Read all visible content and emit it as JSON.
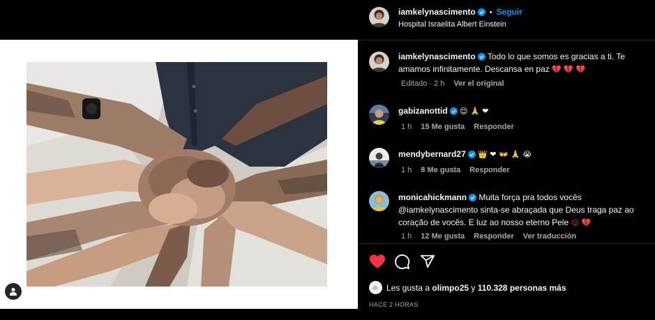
{
  "post": {
    "author": "iamkelynascimento",
    "follow_label": "Seguir",
    "location": "Hospital Israelita Albert Einstein"
  },
  "caption": {
    "username": "iamkelynascimento",
    "text": "Todo lo que somos es gracias a ti. Te amamos infinitamente. Descansa en paz",
    "emojis": "💔 💔 💔",
    "edited": "Editado · 2 h",
    "see_original": "Ver el original"
  },
  "comments": [
    {
      "username": "gabizanottid",
      "text": "",
      "emojis": "😌 🙏 ❤",
      "time": "1 h",
      "likes": "15 Me gusta",
      "reply": "Responder",
      "translate": ""
    },
    {
      "username": "mendybernard27",
      "text": "",
      "emojis": "👑 ❤ 👐 🙏 😭",
      "time": "1 h",
      "likes": "8 Me gusta",
      "reply": "Responder",
      "translate": ""
    },
    {
      "username": "monicahickmann",
      "text": "Muita força pra todos vocês @iamkelynascimento sinta-se abraçada que Deus traga paz ao coração de vocês. E luz ao nosso eterno Pele",
      "emojis": "😌 💔",
      "time": "1 h",
      "likes": "12 Me gusta",
      "reply": "Responder",
      "translate": "Ver traducción"
    }
  ],
  "likes_line": {
    "prefix": "Les gusta a",
    "user": "olimpo25",
    "middle": "y",
    "count": "110.328 personas más"
  },
  "timestamp": "HACE 2 HORAS",
  "icons": {
    "like": "heart-filled-icon",
    "comment": "comment-bubble-icon",
    "share": "paper-plane-icon",
    "verified": "verified-badge-icon",
    "user_tags": "user-tag-icon"
  },
  "colors": {
    "accent": "#0095f6",
    "like": "#ff3040",
    "background": "#000000",
    "muted": "#a8a8a8"
  }
}
